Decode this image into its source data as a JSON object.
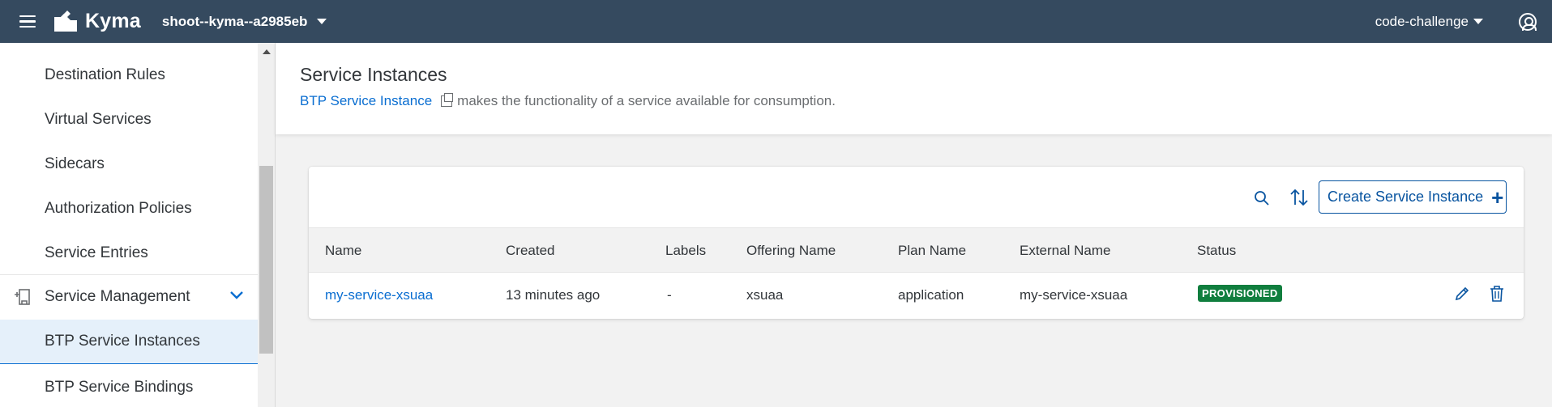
{
  "shell": {
    "brand": "Kyma",
    "cluster": "shoot--kyma--a2985eb",
    "context": "code-challenge"
  },
  "sidebar": {
    "items": [
      {
        "label": "Destination Rules"
      },
      {
        "label": "Virtual Services"
      },
      {
        "label": "Sidecars"
      },
      {
        "label": "Authorization Policies"
      },
      {
        "label": "Service Entries"
      }
    ],
    "group": {
      "label": "Service Management"
    },
    "sub_items": [
      {
        "label": "BTP Service Instances",
        "selected": true
      },
      {
        "label": "BTP Service Bindings"
      }
    ]
  },
  "header": {
    "title": "Service Instances",
    "desc_link": "BTP Service Instance",
    "desc_text": "makes the functionality of a service available for consumption."
  },
  "toolbar": {
    "create_label": "Create Service Instance"
  },
  "table": {
    "columns": [
      "Name",
      "Created",
      "Labels",
      "Offering Name",
      "Plan Name",
      "External Name",
      "Status"
    ],
    "rows": [
      {
        "name": "my-service-xsuaa",
        "created": "13 minutes ago",
        "labels": "-",
        "offering": "xsuaa",
        "plan": "application",
        "external": "my-service-xsuaa",
        "status": "PROVISIONED"
      }
    ]
  },
  "colors": {
    "shell_bg": "#354a5f",
    "accent": "#0a6ed1",
    "status_success": "#107e3e",
    "selected_bg": "#e5f0fa"
  }
}
